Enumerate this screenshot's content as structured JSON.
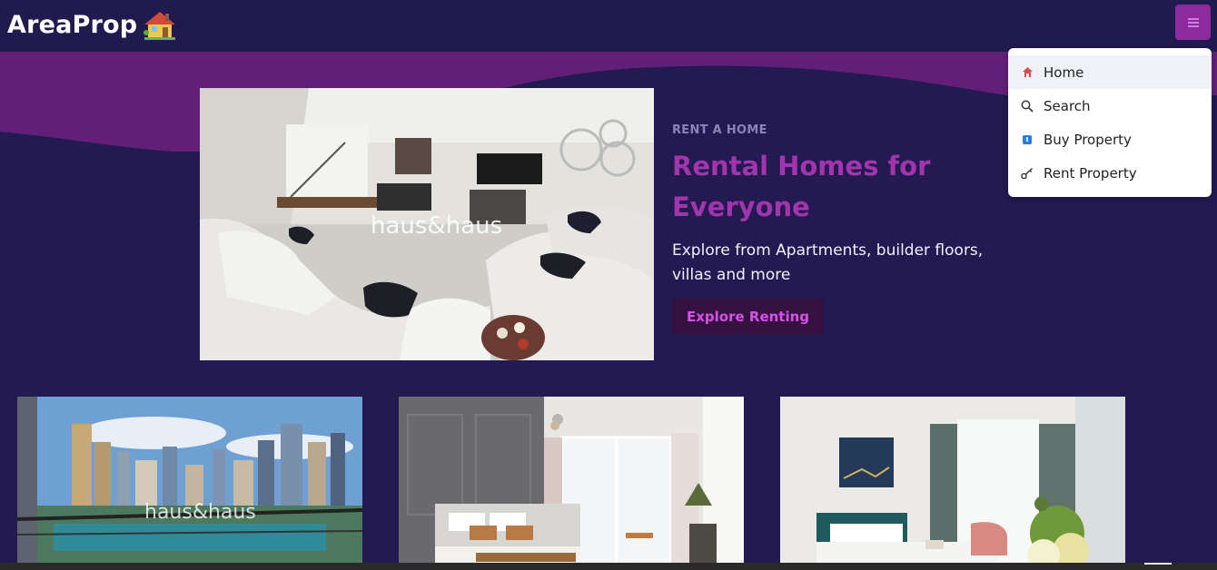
{
  "header": {
    "brand": "AreaProp",
    "brand_icon": "house-icon",
    "menu_icon": "hamburger-icon"
  },
  "menu": {
    "items": [
      {
        "label": "Home",
        "icon": "home-icon",
        "active": true
      },
      {
        "label": "Search",
        "icon": "search-icon",
        "active": false
      },
      {
        "label": "Buy Property",
        "icon": "tag-icon",
        "active": false
      },
      {
        "label": "Rent Property",
        "icon": "key-icon",
        "active": false
      }
    ]
  },
  "hero": {
    "eyebrow": "RENT A HOME",
    "title": "Rental Homes for Everyone",
    "description": "Explore from Apartments, builder floors, villas and more",
    "cta_label": "Explore Renting",
    "image_watermark": "haus&haus"
  },
  "cards": [
    {
      "image": "marina-balcony-view",
      "watermark": "haus&haus"
    },
    {
      "image": "bedroom-sea-view"
    },
    {
      "image": "bedroom-teal-bed"
    }
  ],
  "colors": {
    "background": "#221a51",
    "accent": "#8e2a9d",
    "title": "#a234ad",
    "cta_bg": "#35113f",
    "cta_text": "#d651e7"
  }
}
